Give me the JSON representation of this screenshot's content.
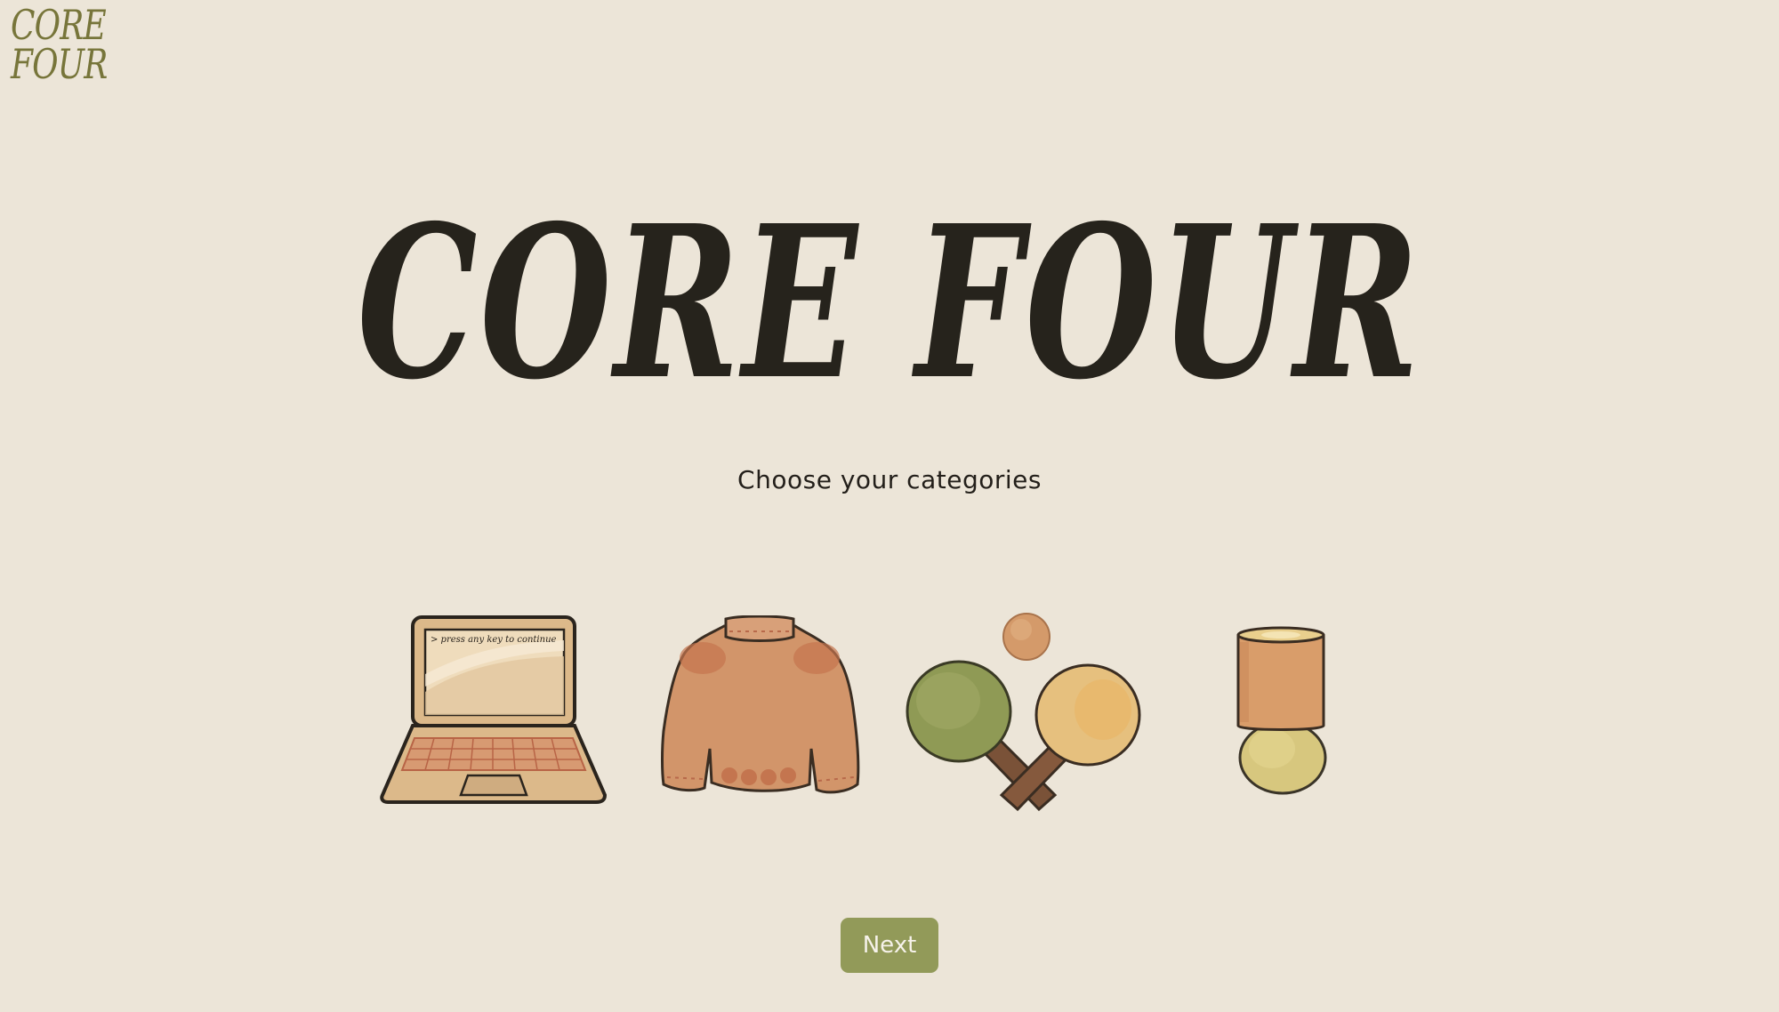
{
  "logo": {
    "line1": "CORE",
    "line2": "FOUR",
    "color": "#77753a"
  },
  "hero": {
    "title": "CORE FOUR"
  },
  "subtitle": "Choose your categories",
  "categories": [
    {
      "icon": "laptop-icon",
      "screen_text": "> press any key to continue"
    },
    {
      "icon": "sweater-icon"
    },
    {
      "icon": "ping-pong-icon"
    },
    {
      "icon": "lamp-icon"
    }
  ],
  "next_button": {
    "label": "Next",
    "color": "#929a59"
  },
  "colors": {
    "background": "#ece5d8",
    "text": "#26231c"
  }
}
